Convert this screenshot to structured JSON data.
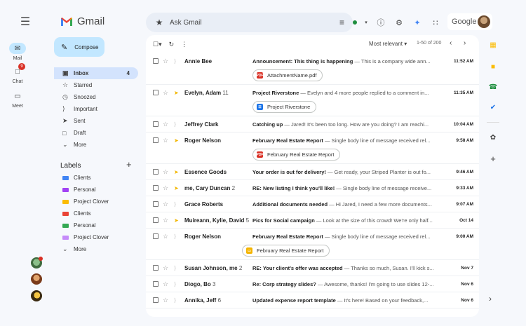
{
  "app": {
    "name": "Gmail"
  },
  "rail": {
    "items": [
      {
        "label": "Mail",
        "icon": "mail-icon"
      },
      {
        "label": "Chat",
        "icon": "chat-icon",
        "badge": "9"
      },
      {
        "label": "Meet",
        "icon": "video-icon"
      }
    ]
  },
  "search": {
    "placeholder": "Ask Gmail"
  },
  "account": {
    "brand": "Google"
  },
  "compose": {
    "label": "Compose"
  },
  "nav": [
    {
      "label": "Inbox",
      "icon": "inbox-icon",
      "count": "4",
      "active": true
    },
    {
      "label": "Starred",
      "icon": "star-icon"
    },
    {
      "label": "Snoozed",
      "icon": "clock-icon"
    },
    {
      "label": "Important",
      "icon": "important-icon"
    },
    {
      "label": "Sent",
      "icon": "send-icon"
    },
    {
      "label": "Draft",
      "icon": "draft-icon"
    },
    {
      "label": "More",
      "icon": "chevron-down-icon"
    }
  ],
  "labels": {
    "title": "Labels",
    "items": [
      {
        "label": "Clients",
        "color": "#4285f4"
      },
      {
        "label": "Personal",
        "color": "#a142f4"
      },
      {
        "label": "Project Clover",
        "color": "#fbbc04"
      },
      {
        "label": "Clients",
        "color": "#ea4335"
      },
      {
        "label": "Personal",
        "color": "#34a853"
      },
      {
        "label": "Project Clover",
        "color": "#c58af9"
      }
    ],
    "more": "More"
  },
  "toolbar": {
    "sort": "Most relevant",
    "range": "1-50 of 200"
  },
  "emails": [
    {
      "sender": "Annie Bee",
      "count": "",
      "subject": "Announcement: This thing is happening",
      "snippet": " — This is a company wide ann...",
      "time": "11:52 AM",
      "important": false,
      "attachment": {
        "label": "AttachmentName.pdf",
        "type": "pdf"
      }
    },
    {
      "sender": "Evelyn, Adam",
      "count": "11",
      "subject": "Project Riverstone",
      "snippet": " — Evelyn and 4 more people replied to a comment in...",
      "time": "11:35 AM",
      "important": true,
      "attachment": {
        "label": "Project Riverstone",
        "type": "doc"
      }
    },
    {
      "sender": "Jeffrey Clark",
      "count": "",
      "subject": "Catching up",
      "snippet": " — Jared! It's been too long. How are you doing? I am reachi...",
      "time": "10:04 AM",
      "important": false
    },
    {
      "sender": "Roger Nelson",
      "count": "",
      "subject": "February Real Estate Report",
      "snippet": " — Single body line of message received rel...",
      "time": "9:58 AM",
      "important": true,
      "attachment": {
        "label": "February Real Estate Report",
        "type": "pdf"
      }
    },
    {
      "sender": "Essence Goods",
      "count": "",
      "subject": "Your order is out for delivery!",
      "snippet": " — Get ready, your Striped Planter is out fo...",
      "time": "9:46 AM",
      "important": true
    },
    {
      "sender": "me, Cary Duncan",
      "count": "2",
      "subject": "RE: New listing I think you'll like!",
      "snippet": " — Single body line of message receive...",
      "time": "9:33 AM",
      "important": true
    },
    {
      "sender": "Grace Roberts",
      "count": "",
      "subject": "Additional documents needed",
      "snippet": " — Hi Jared, I need a few more documents...",
      "time": "9:07 AM",
      "important": false
    },
    {
      "sender": "Muireann, Kylie, David",
      "count": "5",
      "subject": "Pics for Social campaign",
      "snippet": " — Look at the size of this crowd! We're only half...",
      "time": "Oct 14",
      "important": true
    },
    {
      "sender": "Roger Nelson",
      "count": "",
      "subject": "February Real Estate Report",
      "snippet": " — Single body line of message received rel...",
      "time": "9:00 AM",
      "important": false,
      "attachment": {
        "label": "February Real Estate Report",
        "type": "slides"
      }
    },
    {
      "sender": "Susan Johnson, me",
      "count": "2",
      "subject": "RE: Your client's offer was accepted",
      "snippet": " — Thanks so much, Susan. I'll kick s...",
      "time": "Nov 7",
      "important": false
    },
    {
      "sender": "Diogo, Bo",
      "count": "3",
      "subject": "Re: Corp strategy slides?",
      "snippet": " — Awesome, thanks! I'm going to use slides 12-...",
      "time": "Nov 6",
      "important": false
    },
    {
      "sender": "Annika, Jeff",
      "count": "6",
      "subject": "Updated expense report template",
      "snippet": " — It's here! Based on your feedback,...",
      "time": "Nov 6",
      "important": false
    }
  ],
  "colors": {
    "accent": "#c2e7ff",
    "nav_active": "#d3e3fd",
    "important": "#f2b600",
    "background": "#f6f8fc"
  }
}
